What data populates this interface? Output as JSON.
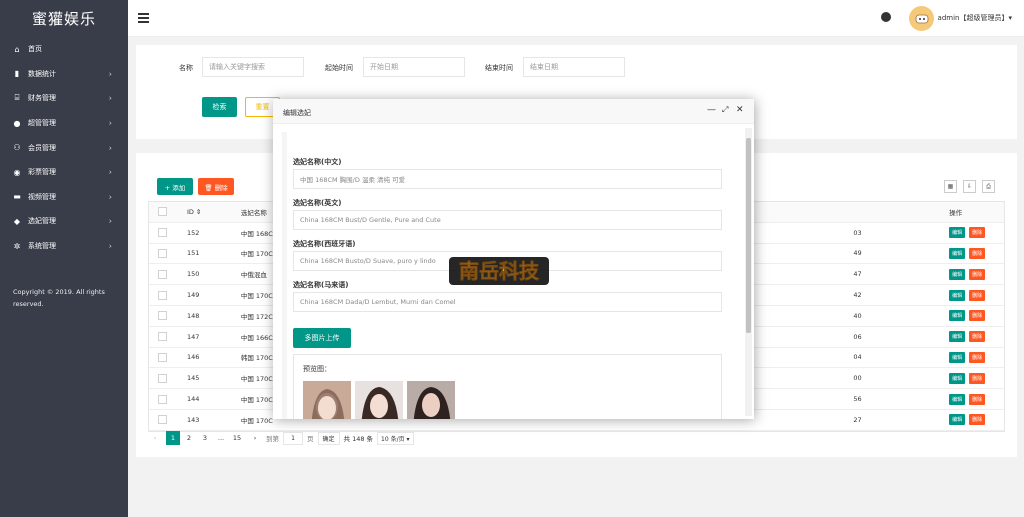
{
  "app": {
    "logo": "蜜獾娱乐"
  },
  "sidebar": {
    "items": [
      {
        "label": "首页",
        "icon": "home-icon",
        "arrow": ""
      },
      {
        "label": "数据统计",
        "icon": "bar-chart-icon",
        "arrow": "›"
      },
      {
        "label": "财务管理",
        "icon": "bank-icon",
        "arrow": "›"
      },
      {
        "label": "超管管理",
        "icon": "user-icon",
        "arrow": "›"
      },
      {
        "label": "会员管理",
        "icon": "users-icon",
        "arrow": "›"
      },
      {
        "label": "彩票管理",
        "icon": "gamepad-icon",
        "arrow": "›"
      },
      {
        "label": "视频管理",
        "icon": "video-icon",
        "arrow": "›"
      },
      {
        "label": "选妃管理",
        "icon": "tag-icon",
        "arrow": "›"
      },
      {
        "label": "系统管理",
        "icon": "gear-icon",
        "arrow": "›"
      }
    ],
    "copyright": "Copyright © 2019. All rights reserved."
  },
  "header": {
    "user": "admin【超级管理员】▾"
  },
  "search": {
    "name_label": "名称",
    "name_placeholder": "请输入关键字搜索",
    "start_label": "起始时间",
    "start_placeholder": "开始日期",
    "end_label": "结束时间",
    "end_placeholder": "结束日期",
    "search_btn": "检索",
    "reset_btn": "重置"
  },
  "toolbar": {
    "add": "+ 添加",
    "delete": "🗑 删除"
  },
  "table": {
    "headers": {
      "id": "ID ⇕",
      "name": "选妃名称",
      "op": "操作"
    },
    "edit_label": "编辑",
    "delete_label": "删除",
    "rows": [
      {
        "id": "152",
        "name": "中国 168C",
        "time": "03"
      },
      {
        "id": "151",
        "name": "中国 170C",
        "time": "49"
      },
      {
        "id": "150",
        "name": "中俄混血",
        "time": "47"
      },
      {
        "id": "149",
        "name": "中国 170C",
        "time": "42"
      },
      {
        "id": "148",
        "name": "中国 172C",
        "time": "40"
      },
      {
        "id": "147",
        "name": "中国 166C",
        "time": "06"
      },
      {
        "id": "146",
        "name": "韩国 170C",
        "time": "04"
      },
      {
        "id": "145",
        "name": "中国 170C",
        "time": "00"
      },
      {
        "id": "144",
        "name": "中国 170C",
        "time": "56"
      },
      {
        "id": "143",
        "name": "中国 170C",
        "time": "27"
      }
    ]
  },
  "pager": {
    "prev": "‹",
    "pages": [
      "1",
      "2",
      "3",
      "...",
      "15"
    ],
    "next": "›",
    "goto_label": "到第",
    "goto_value": "1",
    "page_unit": "页",
    "confirm": "确定",
    "total": "共 148 条",
    "per_page": "10 条/页 ▾"
  },
  "modal": {
    "title": "编辑选妃",
    "fields": [
      {
        "label": "选妃名称(中文)",
        "value": "中国   168CM  胸围/D   温柔  清纯  可爱"
      },
      {
        "label": "选妃名称(英文)",
        "value": "China 168CM Bust/D Gentle, Pure and Cute"
      },
      {
        "label": "选妃名称(西班牙语)",
        "value": "China 168CM Busto/D Suave, puro y lindo"
      },
      {
        "label": "选妃名称(马来语)",
        "value": "China 168CM Dada/D Lembut, Murni dan Comel"
      }
    ],
    "upload_btn": "多图片上传",
    "preview_label": "预览图：",
    "watermark": "南岳科技"
  },
  "colors": {
    "primary": "#009688",
    "danger": "#ff5722",
    "warning": "#f5b800",
    "sidebar": "#393d49"
  }
}
